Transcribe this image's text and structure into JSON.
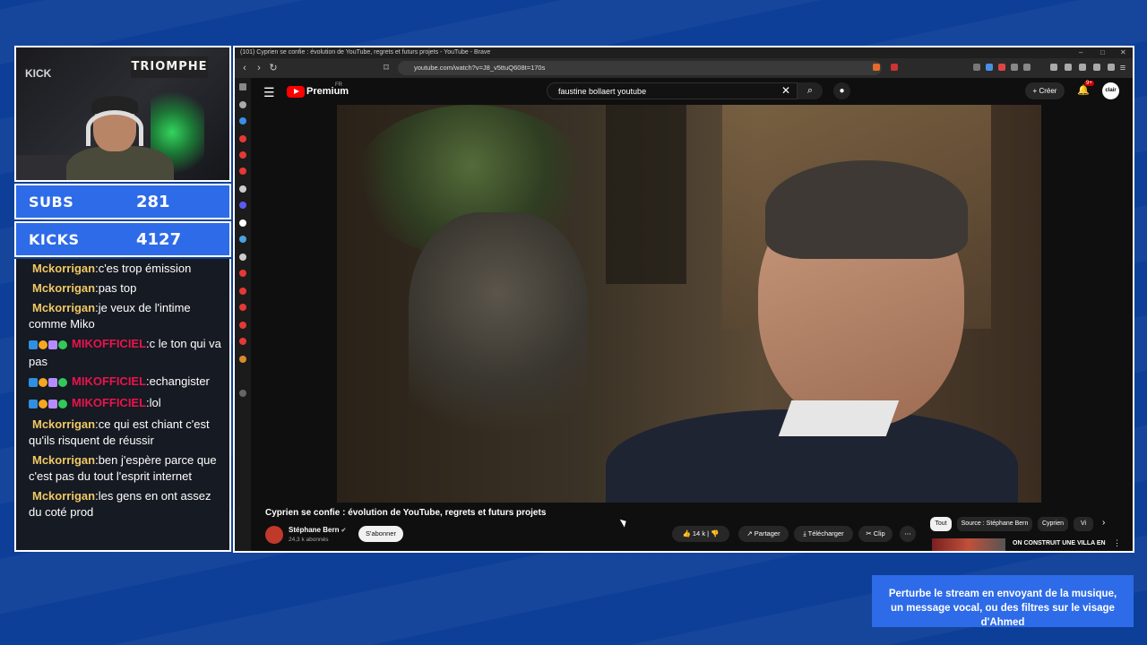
{
  "stream": {
    "subs_label": "SUBS",
    "subs_value": "281",
    "kicks_label": "KICKS",
    "kicks_value": "4127",
    "notice_line1": "Perturbe le stream en envoyant de la musique,",
    "notice_line2": "un message vocal, ou des filtres sur le visage d'Ahmed"
  },
  "webcam": {
    "sign_text": "TRIOMPHE",
    "kick_sign": "KICK"
  },
  "chat": [
    {
      "user": "Mckorrigan",
      "text": "c'es trop émission",
      "badges": false
    },
    {
      "user": "Mckorrigan",
      "text": "pas top",
      "badges": false
    },
    {
      "user": "Mckorrigan",
      "text": "je veux de l'intime comme Miko",
      "badges": false
    },
    {
      "user": "MIKOFFICIEL",
      "text": "c le ton qui va pas",
      "badges": true
    },
    {
      "user": "MIKOFFICIEL",
      "text": "echangister",
      "badges": true
    },
    {
      "user": "MIKOFFICIEL",
      "text": "lol",
      "badges": true
    },
    {
      "user": "Mckorrigan",
      "text": "ce qui est chiant c'est qu'ils risquent de réussir",
      "badges": false
    },
    {
      "user": "Mckorrigan",
      "text": "ben j'espère parce que c'est pas du tout l'esprit internet",
      "badges": false
    },
    {
      "user": "Mckorrigan",
      "text": "les gens en ont assez du coté prod",
      "badges": false
    }
  ],
  "browser": {
    "window_title": "(101) Cyprien se confie : évolution de YouTube, regrets et futurs projets - YouTube - Brave",
    "url": "youtube.com/watch?v=J8_v5ttuQ608t=170s",
    "win_min": "–",
    "win_max": "□",
    "win_close": "✕"
  },
  "youtube": {
    "brand": "Premium",
    "brand_region": "FR",
    "search_value": "faustine bollaert  youtube",
    "create_label": "Créer",
    "bell_count": "9+",
    "avatar_text": "clair",
    "video_title": "Cyprien se confie : évolution de YouTube, regrets et futurs projets",
    "channel_name": "Stéphane Bern",
    "channel_subs": "24,3 k abonnés",
    "subscribe_label": "S'abonner",
    "like_count": "14 k",
    "share_label": "Partager",
    "download_label": "Télécharger",
    "clip_label": "Clip",
    "chips": [
      "Tout",
      "Source : Stéphane Bern",
      "Cyprien",
      "Vi"
    ],
    "rec_title": "ON CONSTRUIT UNE VILLA EN"
  },
  "colors": {
    "background": "#0d3f98",
    "accent_blue": "#2e6be8",
    "chat_user": "#f0c864",
    "chat_user_red": "#e8144c",
    "youtube_red": "#ff0000"
  }
}
